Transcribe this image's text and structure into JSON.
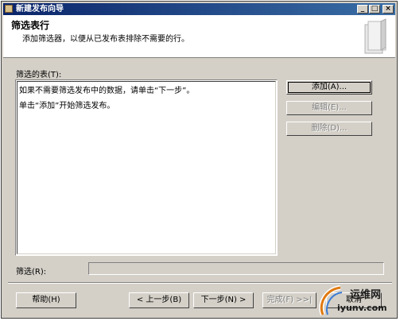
{
  "window": {
    "title": "新建发布向导"
  },
  "header": {
    "title": "筛选表行",
    "description": "添加筛选器，以便从已发布表排除不需要的行。"
  },
  "filtered_tables": {
    "label": "筛选的表(T):",
    "lines": [
      "如果不需要筛选发布中的数据，请单击“下一步”。",
      "单击“添加”开始筛选发布。"
    ]
  },
  "side_buttons": {
    "add": "添加(A)...",
    "edit": "编辑(E)...",
    "delete": "删除(D)..."
  },
  "filter": {
    "label": "筛选(R):",
    "value": ""
  },
  "footer": {
    "help": "帮助(H)",
    "back": "< 上一步(B)",
    "next": "下一步(N) >",
    "finish": "完成(F) >>|",
    "cancel": "取消"
  },
  "watermark": {
    "brand": "运维网",
    "site": "iyunv.com"
  }
}
